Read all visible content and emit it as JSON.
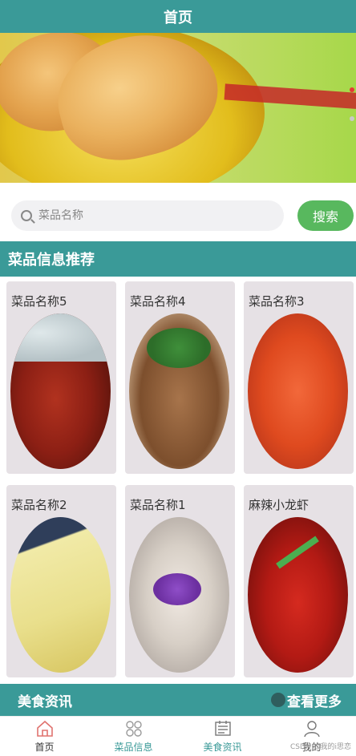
{
  "header": {
    "title": "首页"
  },
  "banner": {
    "indicator_count": 2,
    "active_index": 0
  },
  "search": {
    "placeholder": "菜品名称",
    "button_label": "搜索"
  },
  "recommend": {
    "title": "菜品信息推荐",
    "items": [
      {
        "name": "菜品名称5"
      },
      {
        "name": "菜品名称4"
      },
      {
        "name": "菜品名称3"
      },
      {
        "name": "菜品名称2"
      },
      {
        "name": "菜品名称1"
      },
      {
        "name": "麻辣小龙虾"
      }
    ]
  },
  "news": {
    "title": "美食资讯",
    "more_label": "查看更多"
  },
  "tabbar": {
    "items": [
      {
        "label": "首页",
        "icon": "home-icon"
      },
      {
        "label": "菜品信息",
        "icon": "grid-icon"
      },
      {
        "label": "美食资讯",
        "icon": "news-icon"
      },
      {
        "label": "我的",
        "icon": "user-icon"
      }
    ]
  },
  "watermark": "CSDN @我的i思恋",
  "colors": {
    "primary": "#3a9a98",
    "search_button": "#58b85e",
    "card_bg": "#e6e1e5"
  }
}
